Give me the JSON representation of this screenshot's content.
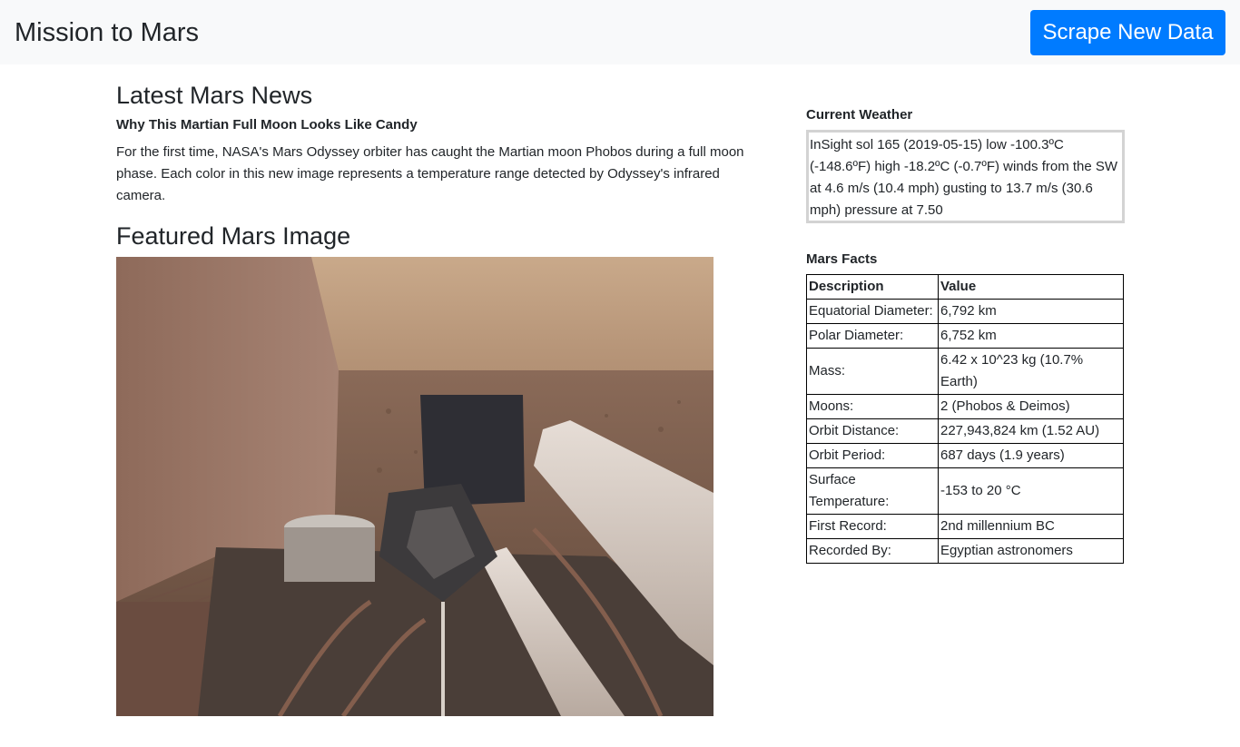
{
  "navbar": {
    "brand": "Mission to Mars",
    "scrape_button": "Scrape New Data",
    "button_color": "#007bff",
    "background": "#f8f9fa"
  },
  "news": {
    "heading": "Latest Mars News",
    "title": "Why This Martian Full Moon Looks Like Candy",
    "paragraph": "For the first time, NASA's Mars Odyssey orbiter has caught the Martian moon Phobos during a full moon phase. Each color in this new image represents a temperature range detected by Odyssey's infrared camera."
  },
  "featured": {
    "heading": "Featured Mars Image",
    "image_alt": "InSight lander deck with robotic arm on Martian surface"
  },
  "weather": {
    "heading": "Current Weather",
    "text": "InSight sol 165 (2019-05-15) low -100.3ºC (-148.6ºF) high -18.2ºC (-0.7ºF) winds from the SW at 4.6 m/s (10.4 mph) gusting to 13.7 m/s (30.6 mph) pressure at 7.50"
  },
  "facts": {
    "heading": "Mars Facts",
    "columns": [
      "Description",
      "Value"
    ],
    "rows": [
      {
        "description": "Equatorial Diameter:",
        "value": "6,792 km"
      },
      {
        "description": "Polar Diameter:",
        "value": "6,752 km"
      },
      {
        "description": "Mass:",
        "value": "6.42 x 10^23 kg (10.7% Earth)"
      },
      {
        "description": "Moons:",
        "value": "2 (Phobos & Deimos)"
      },
      {
        "description": "Orbit Distance:",
        "value": "227,943,824 km (1.52 AU)"
      },
      {
        "description": "Orbit Period:",
        "value": "687 days (1.9 years)"
      },
      {
        "description": "Surface Temperature:",
        "value": "-153 to 20 °C"
      },
      {
        "description": "First Record:",
        "value": "2nd millennium BC"
      },
      {
        "description": "Recorded By:",
        "value": "Egyptian astronomers"
      }
    ]
  }
}
